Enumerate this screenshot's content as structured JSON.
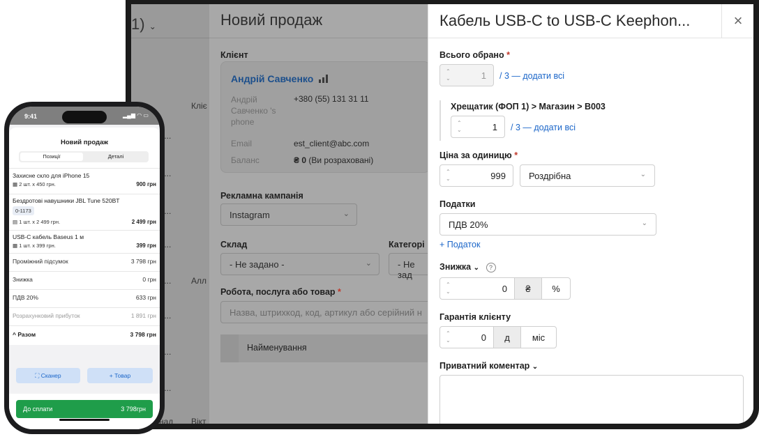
{
  "background_page": {
    "left_fragment": {
      "title": "1)",
      "header_col": "Кліє",
      "row_suffix": ") ...",
      "alt1": "Алл",
      "bottom1": "над",
      "bottom2": "Вікт"
    },
    "title": "Новий продаж",
    "client_label": "Клієнт",
    "client": {
      "name": "Андрій Савченко",
      "phone_label": "Андрій Савченко 's phone",
      "phone": "+380 (55) 131 31 11",
      "email_label": "Email",
      "email": "est_client@abc.com",
      "balance_label": "Баланс",
      "balance_value": "₴ 0",
      "balance_note": "(Ви розраховані)"
    },
    "campaign_label": "Рекламна кампанія",
    "campaign_value": "Instagram",
    "warehouse_label": "Склад",
    "warehouse_value": "- Не задано -",
    "category_label": "Категорі",
    "category_value": "- Не зад",
    "product_label": "Робота, послуга або товар",
    "product_placeholder": "Назва, штрихкод, код, артикул або серійний н",
    "table_header": "Найменування"
  },
  "panel": {
    "title": "Кабель USB-C to USB-C Keephon...",
    "total_selected_label": "Всього обрано",
    "total_selected_value": "1",
    "total_add_all": "/ 3 — додати всі",
    "location": "Хрещатик (ФОП 1) > Магазин > B003",
    "location_qty": "1",
    "location_add_all": "/ 3 — додати всі",
    "unit_price_label": "Ціна за одиницю",
    "unit_price": "999",
    "price_type": "Роздрібна",
    "taxes_label": "Податки",
    "tax_value": "ПДВ 20%",
    "add_tax": "+ Податок",
    "discount_label": "Знижка",
    "discount_value": "0",
    "discount_currency": "₴",
    "discount_percent": "%",
    "warranty_label": "Гарантія клієнту",
    "warranty_value": "0",
    "warranty_days": "д",
    "warranty_months": "міс",
    "comment_label": "Приватний коментар"
  },
  "phone": {
    "time": "9:41",
    "title": "Новий продаж",
    "tab_positions": "Позиції",
    "tab_details": "Деталі",
    "items": [
      {
        "name": "Захисне скло для iPhone 15",
        "qty": "2 шт. x 450 грн.",
        "price": "900 грн"
      },
      {
        "name": "Бездротові навушники JBL Tune 520BT",
        "serial": "0-1173",
        "qty": "1 шт. x 2 499 грн.",
        "price": "2 499 грн"
      },
      {
        "name": "USB-C кабель Baseus 1 м",
        "qty": "1 шт. x 399 грн.",
        "price": "399 грн"
      }
    ],
    "subtotal_label": "Проміжний підсумок",
    "subtotal": "3 798 грн",
    "discount_label": "Знижка",
    "discount": "0 грн",
    "vat_label": "ПДВ 20%",
    "vat": "633 грн",
    "profit_label": "Розрахунковий прибуток",
    "profit": "1 891 грн",
    "total_label": "Разом",
    "total": "3 798 грн",
    "scanner_btn": "Сканер",
    "add_item_btn": "+ Товар",
    "pay_label": "До сплати",
    "pay_amount": "3 798грн"
  }
}
